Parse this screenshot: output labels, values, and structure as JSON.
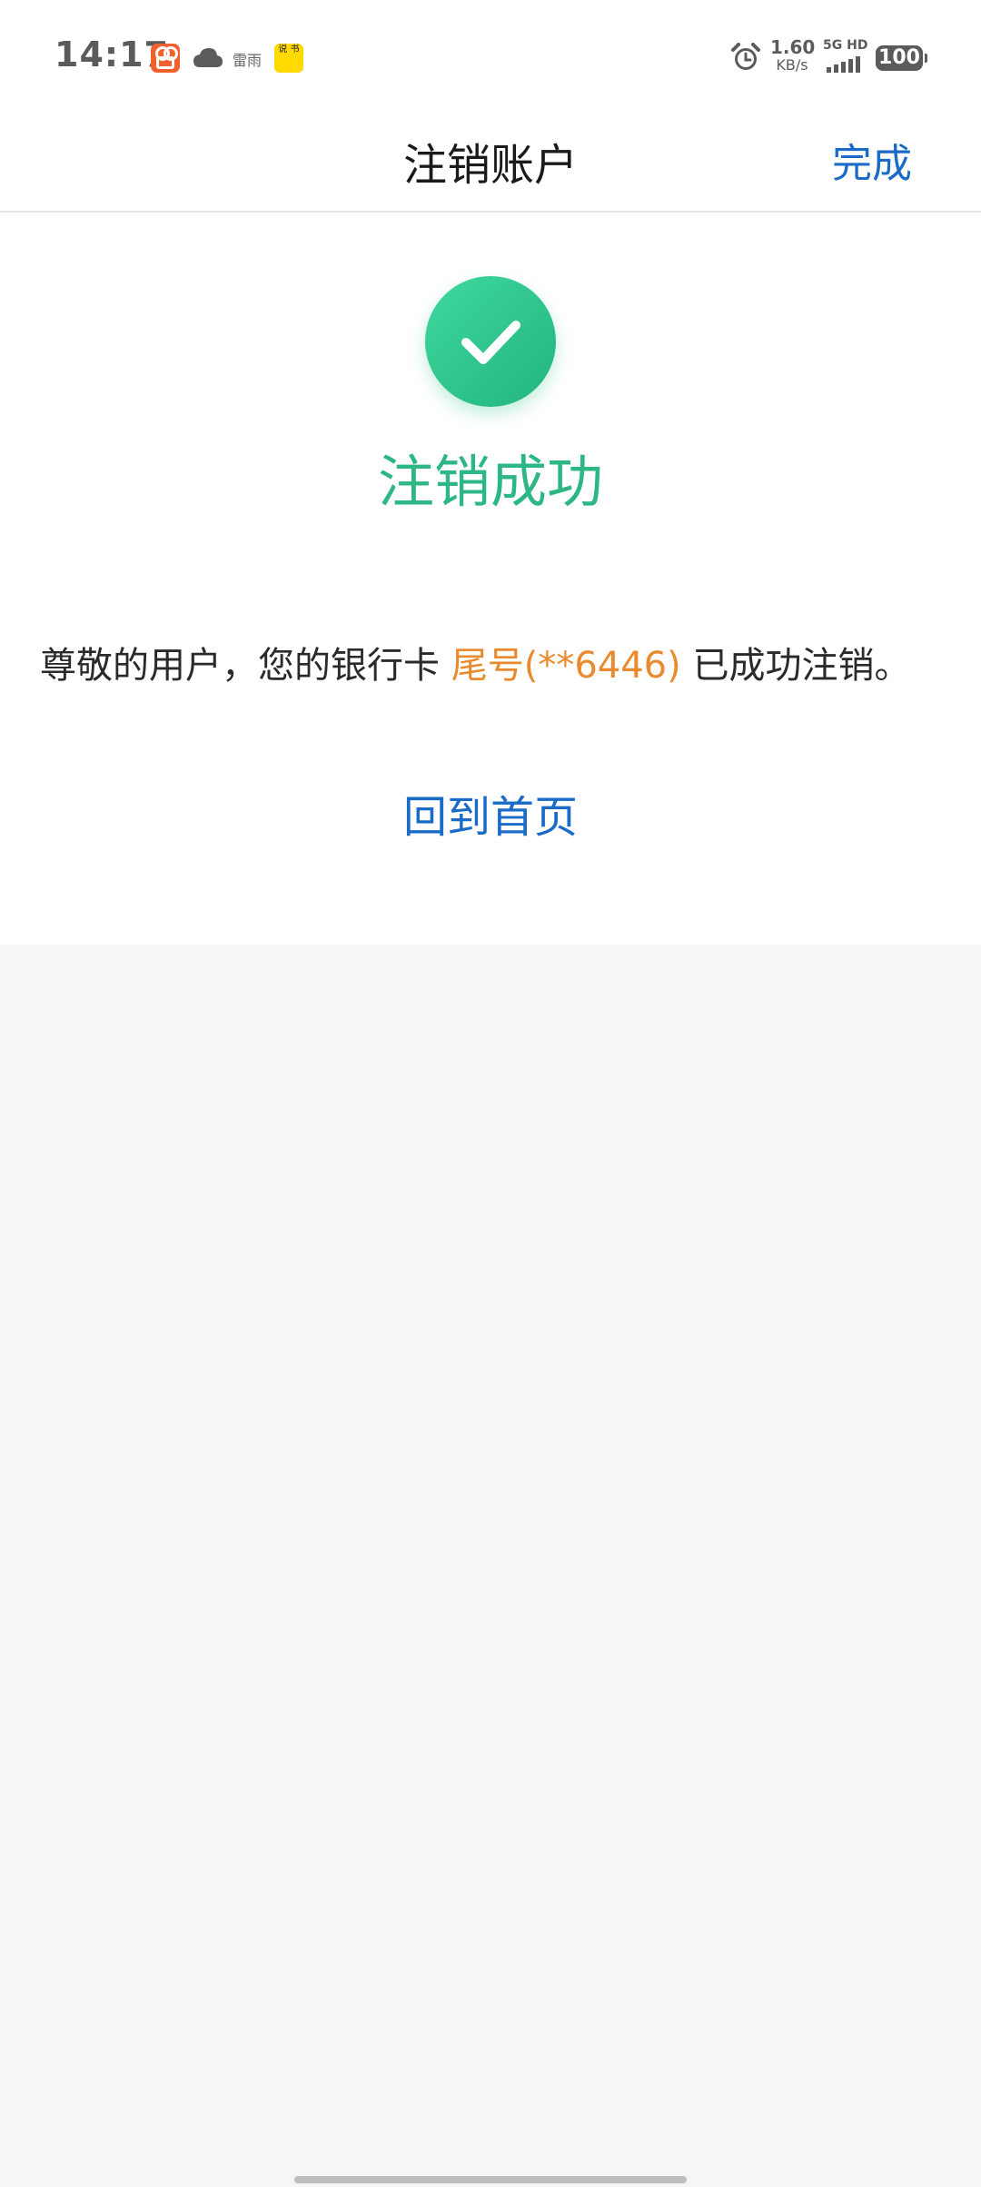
{
  "status_bar": {
    "time": "14:17",
    "weather_text": "雷雨",
    "app_badge_text": "说 书",
    "net_speed_value": "1.60",
    "net_speed_unit": "KB/s",
    "signal_label": "5G HD",
    "battery": "100"
  },
  "nav": {
    "title": "注销账户",
    "done_label": "完成"
  },
  "result": {
    "title": "注销成功",
    "message_prefix": "尊敬的用户，您的银行卡 ",
    "message_card": "尾号(**6446)",
    "message_suffix": " 已成功注销。",
    "home_link": "回到首页"
  },
  "colors": {
    "success_green": "#2cb784",
    "link_blue": "#1a6bc8",
    "highlight_orange": "#ea8a2e",
    "background_gray": "#f6f6f6"
  },
  "icons": {
    "success": "checkmark-circle-icon",
    "alarm": "alarm-clock-icon",
    "weather": "cloud-icon"
  }
}
